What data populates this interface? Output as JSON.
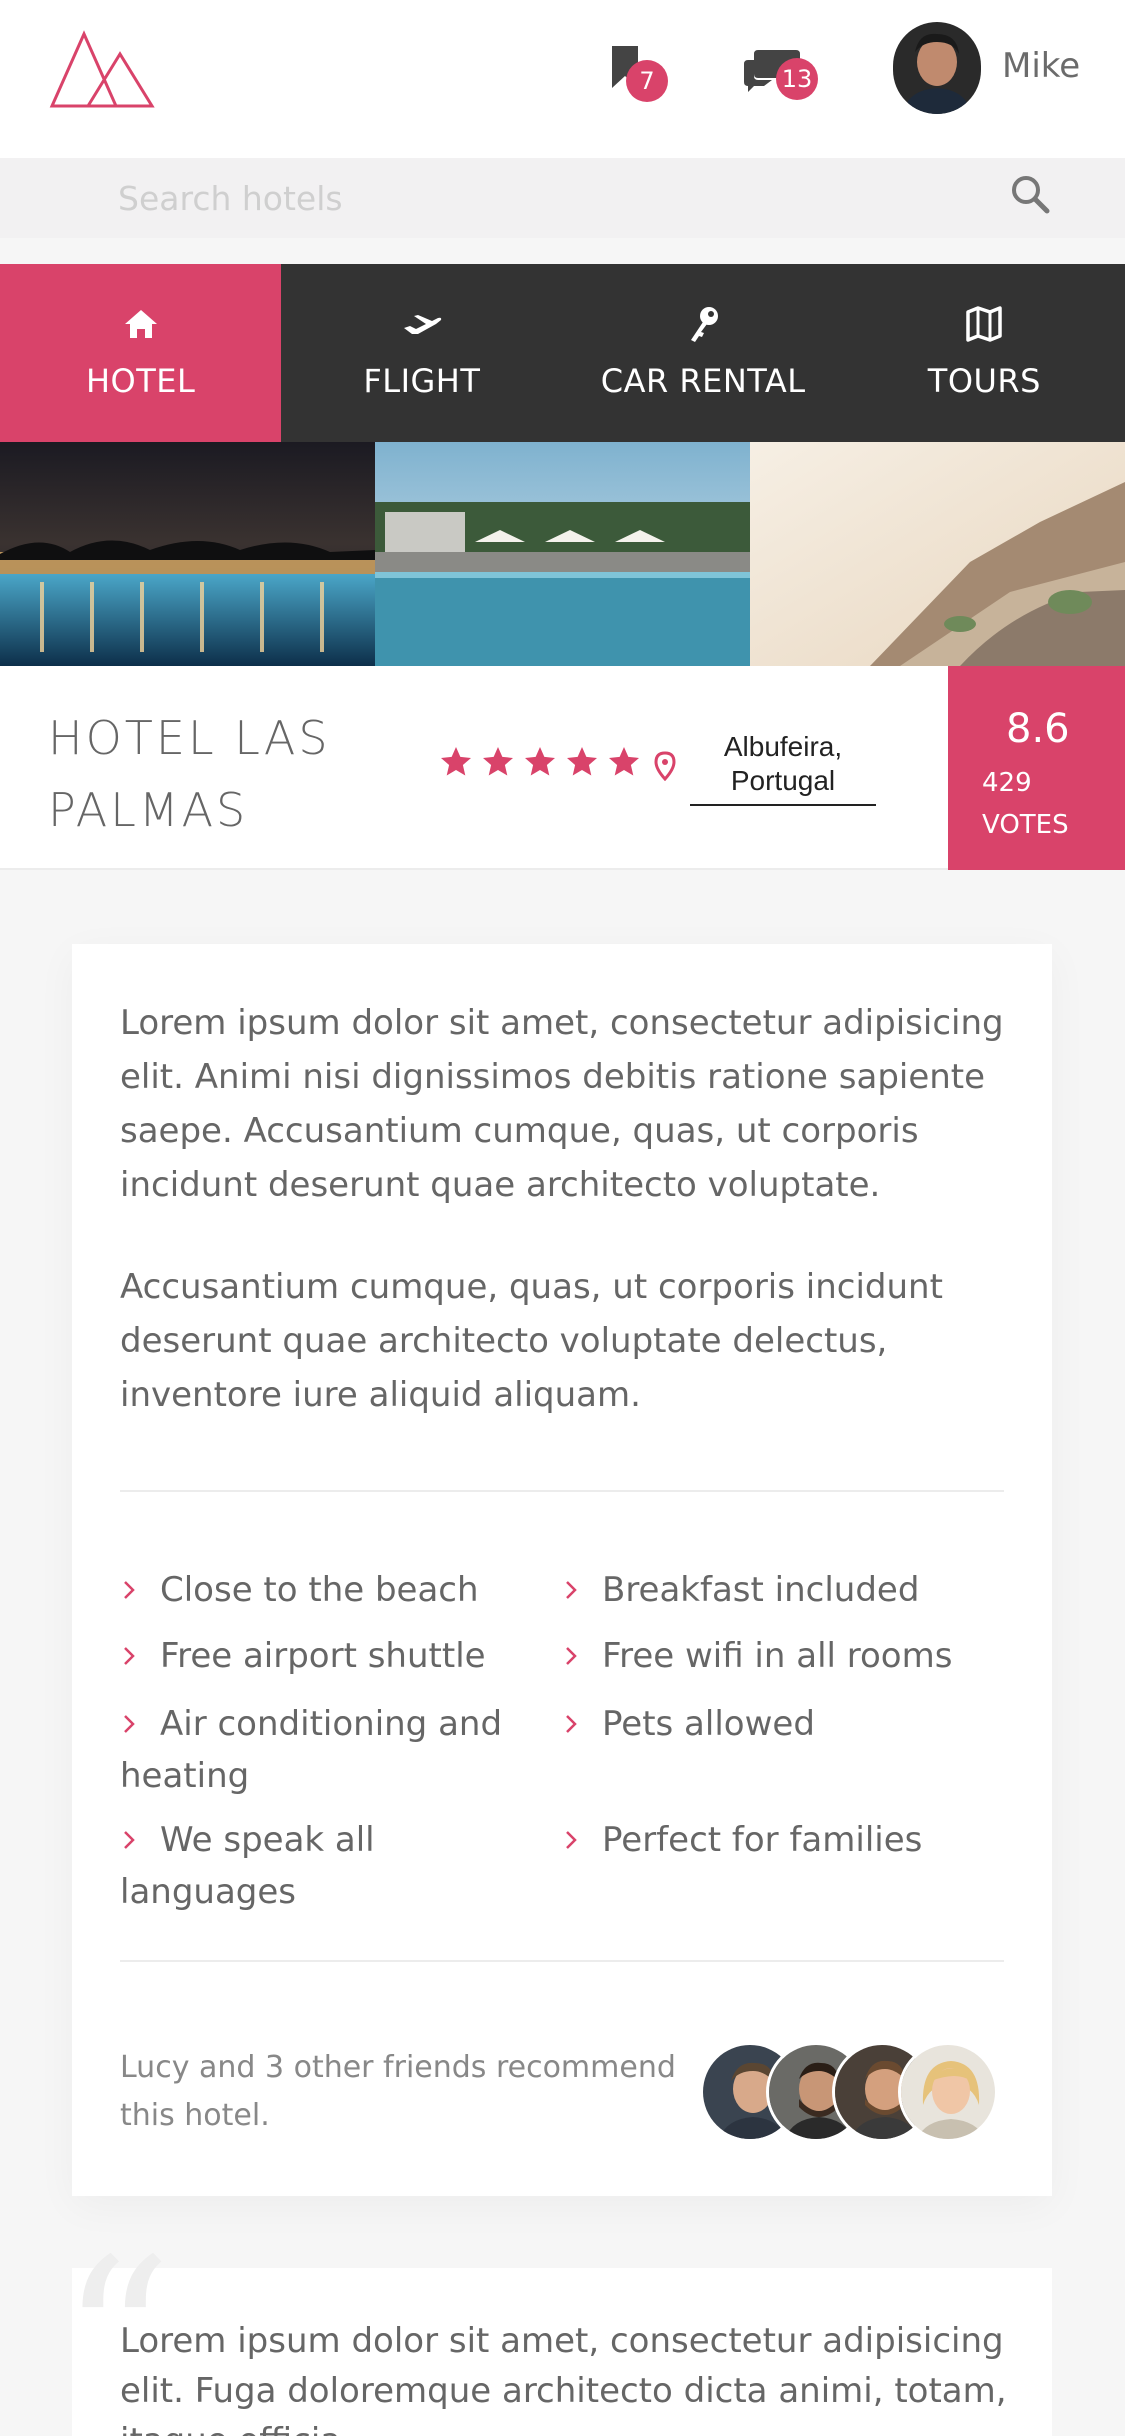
{
  "header": {
    "username": "Mike",
    "bookmarks_count": "7",
    "messages_count": "13",
    "brand_color": "#d9436a"
  },
  "search": {
    "placeholder": "Search hotels"
  },
  "tabs": [
    {
      "label": "HOTEL",
      "icon": "home-icon",
      "active": true
    },
    {
      "label": "FLIGHT",
      "icon": "plane-icon",
      "active": false
    },
    {
      "label": "CAR RENTAL",
      "icon": "key-icon",
      "active": false
    },
    {
      "label": "TOURS",
      "icon": "map-icon",
      "active": false
    }
  ],
  "hotel": {
    "name": "HOTEL LAS PALMAS",
    "stars": 5,
    "location": "Albufeira, Portugal",
    "score": "8.6",
    "votes": "429",
    "votes_label": "VOTES"
  },
  "description": {
    "p1": "Lorem ipsum dolor sit amet, consectetur adipisicing elit. Animi nisi dignissimos debitis ratione sapiente saepe. Accusantium cumque, quas, ut corporis incidunt deserunt quae architecto voluptate.",
    "p2": "Accusantium cumque, quas, ut corporis incidunt deserunt quae architecto voluptate delectus, inventore iure aliquid aliquam."
  },
  "features": [
    "Close to the beach",
    "Breakfast included",
    "Free airport shuttle",
    "Free wifi in all rooms",
    "Air conditioning and heating",
    "Pets allowed",
    "We speak all languages",
    "Perfect for families"
  ],
  "recommendation": "Lucy and 3 other friends recommend this hotel.",
  "quote": "Lorem ipsum dolor sit amet, consectetur adipisicing elit. Fuga doloremque architecto dicta animi, totam, itaque officia"
}
